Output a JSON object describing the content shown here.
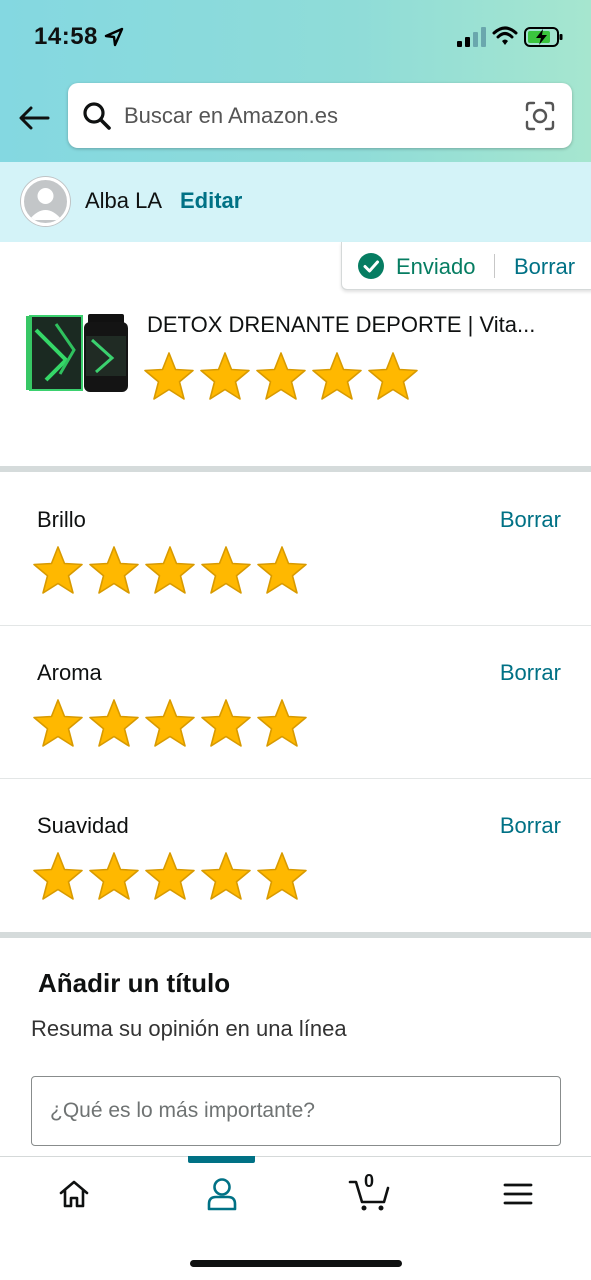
{
  "status_bar": {
    "time": "14:58"
  },
  "search": {
    "placeholder": "Buscar en Amazon.es"
  },
  "profile": {
    "name": "Alba LA",
    "edit_label": "Editar"
  },
  "review_status": {
    "sent_label": "Enviado",
    "delete_label": "Borrar"
  },
  "product": {
    "title": "DETOX DRENANTE DEPORTE | Vita...",
    "rating": 5,
    "max_rating": 5
  },
  "attributes": [
    {
      "label": "Brillo",
      "delete_label": "Borrar",
      "rating": 5
    },
    {
      "label": "Aroma",
      "delete_label": "Borrar",
      "rating": 5
    },
    {
      "label": "Suavidad",
      "delete_label": "Borrar",
      "rating": 5
    }
  ],
  "title_section": {
    "heading": "Añadir un título",
    "subheading": "Resuma su opinión en una línea",
    "input_placeholder": "¿Qué es lo más importante?"
  },
  "bottom_nav": {
    "items": [
      "home-icon",
      "account-icon",
      "cart-icon",
      "menu-icon"
    ],
    "cart_count": "0",
    "active": "account-icon"
  },
  "colors": {
    "link": "#007185",
    "success": "#067d62",
    "star": "#ffb800",
    "header_gradient": "#84d8e1"
  }
}
